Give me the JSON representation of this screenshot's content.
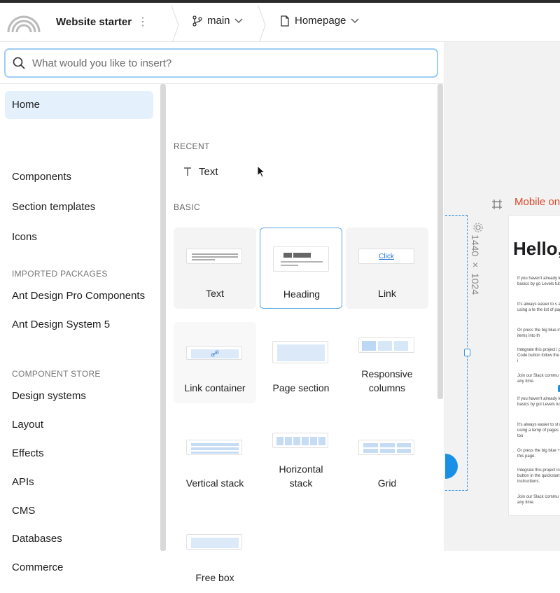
{
  "header": {
    "project_name": "Website starter",
    "branch": "main",
    "page": "Homepage"
  },
  "search": {
    "placeholder": "What would you like to insert?"
  },
  "nav": {
    "items": [
      {
        "label": "Home",
        "active": true
      },
      {
        "label": "Components"
      },
      {
        "label": "Section templates"
      },
      {
        "label": "Icons"
      }
    ],
    "imported_heading": "IMPORTED PACKAGES",
    "imported": [
      {
        "label": "Ant Design Pro Components"
      },
      {
        "label": "Ant Design System 5"
      }
    ],
    "store_heading": "COMPONENT STORE",
    "store": [
      {
        "label": "Design systems"
      },
      {
        "label": "Layout"
      },
      {
        "label": "Effects"
      },
      {
        "label": "APIs"
      },
      {
        "label": "CMS"
      },
      {
        "label": "Databases"
      },
      {
        "label": "Commerce"
      }
    ]
  },
  "insert": {
    "recent_heading": "RECENT",
    "recent_item": "Text",
    "basic_heading": "BASIC",
    "tiles": [
      {
        "label": "Text",
        "icon": "text-block-icon"
      },
      {
        "label": "Heading",
        "icon": "heading-block-icon",
        "selected": true
      },
      {
        "label": "Link",
        "icon": "link-block-icon",
        "thumb_text": "Click"
      },
      {
        "label": "Link container",
        "icon": "link-container-icon"
      },
      {
        "label": "Page section",
        "icon": "page-section-icon"
      },
      {
        "label": "Responsive columns",
        "icon": "responsive-columns-icon"
      },
      {
        "label": "Vertical stack",
        "icon": "vertical-stack-icon"
      },
      {
        "label": "Horizontal stack",
        "icon": "horizontal-stack-icon"
      },
      {
        "label": "Grid",
        "icon": "grid-block-icon"
      },
      {
        "label": "Free box",
        "icon": "free-box-icon"
      }
    ]
  },
  "canvas": {
    "dimensions": "1440 × 1024",
    "mobile_label": "Mobile on",
    "hello": "Hello,",
    "paragraphs": [
      "If you haven't already learn the basics by go Levels tutorial.",
      "It's always easier to s a new page using a te the list of pages in the",
      "Or press the big blue inserting items into th",
      "Integrate this project i press the Code button follow the quickstart i",
      "Join our Slack commu for help any time.",
      "If you haven't already learn the basics by goi Levels tutorial.",
      "It's always easier to st new page using a temp of pages in the top too",
      "Or press the big blue + items into this page.",
      "Integrate this project in the Code button in the quickstart instructions.",
      "Join our Slack commu for help any time."
    ]
  },
  "colors": {
    "accent": "#1a8fe6",
    "selected_bg": "#e4f1fc",
    "mobile_label": "#d9482b"
  }
}
